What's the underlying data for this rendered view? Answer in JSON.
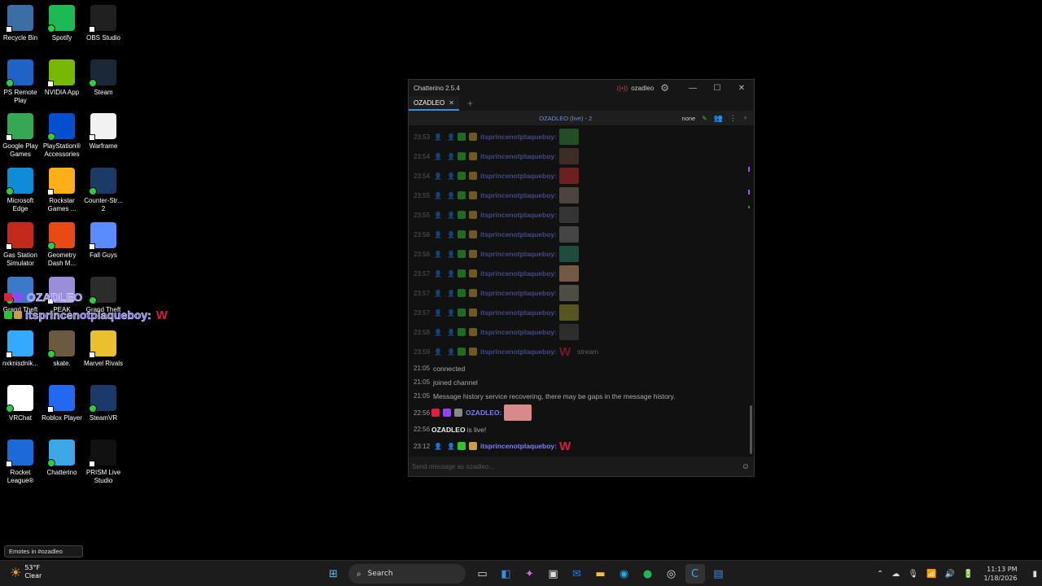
{
  "desktop_icons": [
    {
      "label": "Recycle Bin",
      "icon": "recycle-bin-icon",
      "color": "#3a6ea5"
    },
    {
      "label": "Spotify",
      "icon": "spotify-icon",
      "color": "#1db954"
    },
    {
      "label": "OBS Studio",
      "icon": "obs-icon",
      "color": "#202020"
    },
    {
      "label": "PS Remote Play",
      "icon": "ps-remote-play-icon",
      "color": "#1e63c7"
    },
    {
      "label": "NVIDIA App",
      "icon": "nvidia-icon",
      "color": "#76b900"
    },
    {
      "label": "Steam",
      "icon": "steam-icon",
      "color": "#1b2838"
    },
    {
      "label": "Google Play Games",
      "icon": "google-play-games-icon",
      "color": "#34a853"
    },
    {
      "label": "PlayStation® Accessories",
      "icon": "playstation-icon",
      "color": "#0050d0"
    },
    {
      "label": "Warframe",
      "icon": "warframe-icon",
      "color": "#f2f2f2"
    },
    {
      "label": "Microsoft Edge",
      "icon": "edge-icon",
      "color": "#0f8cd6"
    },
    {
      "label": "Rockstar Games ...",
      "icon": "rockstar-icon",
      "color": "#fcaf17"
    },
    {
      "label": "Counter-Str... 2",
      "icon": "counter-strike-icon",
      "color": "#1c3a66"
    },
    {
      "label": "Gas Station Simulator",
      "icon": "gas-station-icon",
      "color": "#c42a1c"
    },
    {
      "label": "Geometry Dash M...",
      "icon": "geometry-dash-icon",
      "color": "#e84a14"
    },
    {
      "label": "Fall Guys",
      "icon": "fall-guys-icon",
      "color": "#5a8cff"
    },
    {
      "label": "Grand Theft",
      "icon": "gta-icon",
      "color": "#3a7ac8"
    },
    {
      "label": "PEAK",
      "icon": "peak-icon",
      "color": "#9a8ed8"
    },
    {
      "label": "Grand Theft",
      "icon": "gta-v-icon",
      "color": "#2c2c2c"
    },
    {
      "label": "nxknisdnik...",
      "icon": "fortnite-icon",
      "color": "#33aaff"
    },
    {
      "label": "skate.",
      "icon": "skate-icon",
      "color": "#6a5a40"
    },
    {
      "label": "Marvel Rivals",
      "icon": "marvel-rivals-icon",
      "color": "#e8c22e"
    },
    {
      "label": "VRChat",
      "icon": "vrchat-icon",
      "color": "#ffffff"
    },
    {
      "label": "Roblox Player",
      "icon": "roblox-icon",
      "color": "#2268f0"
    },
    {
      "label": "SteamVR",
      "icon": "steamvr-icon",
      "color": "#1b3a6a"
    },
    {
      "label": "Rocket League®",
      "icon": "rocket-league-icon",
      "color": "#1a6ad8"
    },
    {
      "label": "Chatterino",
      "icon": "chatterino-icon",
      "color": "#3da8e8"
    },
    {
      "label": "PRISM Live Studio",
      "icon": "prism-icon",
      "color": "#111111"
    }
  ],
  "overlay": {
    "user1": "OZADLEO",
    "user2": "itsprincenotplaqueboy:",
    "msg": "W"
  },
  "window": {
    "title": "Chatterino 2.5.4",
    "account": "ozadleo",
    "tab": "OZADLEO",
    "channel_header": "OZADLEO (live) - 2",
    "mode": "none",
    "input_placeholder": "Send message as ozadleo..."
  },
  "messages": [
    {
      "ts": "23:53",
      "user": "itsprincenotplaqueboy:",
      "emote": "#3a8a3a"
    },
    {
      "ts": "23:54",
      "user": "itsprincenotplaqueboy:",
      "emote": "#6a4a3a"
    },
    {
      "ts": "23:54",
      "user": "itsprincenotplaqueboy:",
      "emote": "#c83030"
    },
    {
      "ts": "23:55",
      "user": "itsprincenotplaqueboy:",
      "emote": "#8a7a6a"
    },
    {
      "ts": "23:55",
      "user": "itsprincenotplaqueboy:",
      "emote": "#5a5a5a"
    },
    {
      "ts": "23:56",
      "user": "itsprincenotplaqueboy:",
      "emote": "#7a7a7a"
    },
    {
      "ts": "23:56",
      "user": "itsprincenotplaqueboy:",
      "emote": "#2a8a6a"
    },
    {
      "ts": "23:57",
      "user": "itsprincenotplaqueboy:",
      "emote": "#d8a07a"
    },
    {
      "ts": "23:57",
      "user": "itsprincenotplaqueboy:",
      "emote": "#8a8a7a"
    },
    {
      "ts": "23:57",
      "user": "itsprincenotplaqueboy:",
      "emote": "#9a9a2a"
    },
    {
      "ts": "23:58",
      "user": "itsprincenotplaqueboy:",
      "emote": "#4a4a4a"
    },
    {
      "ts": "23:59",
      "user": "itsprincenotplaqueboy:",
      "w": "W",
      "text": "stream"
    }
  ],
  "system_messages": [
    {
      "ts": "21:05",
      "text": "connected"
    },
    {
      "ts": "21:05",
      "text": "joined channel"
    },
    {
      "ts": "21:05",
      "text": "Message history service recovering, there may be gaps in the message history."
    }
  ],
  "live_messages": [
    {
      "ts": "22:56",
      "user": "OZADLEO:"
    },
    {
      "ts": "22:56",
      "bold": "OZADLEO",
      "text": "is live!"
    },
    {
      "ts": "23:12",
      "user": "itsprincenotplaqueboy:",
      "w": "W"
    }
  ],
  "tooltip": "Emotes in #ozadleo",
  "taskbar": {
    "temp": "53°F",
    "weather": "Clear",
    "search": "Search",
    "time": "11:13 PM",
    "date": "1/18/2026"
  }
}
